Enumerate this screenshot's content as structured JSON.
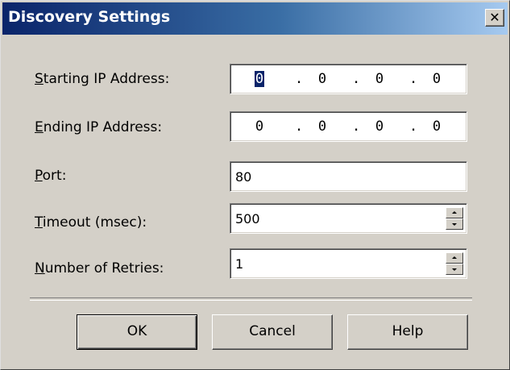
{
  "dialog": {
    "title": "Discovery Settings",
    "close_glyph": "✕"
  },
  "fields": {
    "start_ip": {
      "label_mnemonic": "S",
      "label_rest": "tarting IP Address:",
      "octets": [
        "0",
        "0",
        "0",
        "0"
      ]
    },
    "end_ip": {
      "label_mnemonic": "E",
      "label_rest": "nding IP Address:",
      "octets": [
        "0",
        "0",
        "0",
        "0"
      ]
    },
    "port": {
      "label_mnemonic": "P",
      "label_rest": "ort:",
      "value": "80"
    },
    "timeout": {
      "label_mnemonic": "T",
      "label_rest": "imeout (msec):",
      "value": "500"
    },
    "retries": {
      "label_mnemonic": "N",
      "label_rest": "umber of Retries:",
      "value": "1"
    }
  },
  "buttons": {
    "ok": "OK",
    "cancel": "Cancel",
    "help": "Help"
  },
  "ip_separator": ".",
  "colors": {
    "title_gradient_start": "#0a246a",
    "title_gradient_end": "#a6caf0",
    "face": "#d4d0c8",
    "selection": "#0a246a"
  }
}
